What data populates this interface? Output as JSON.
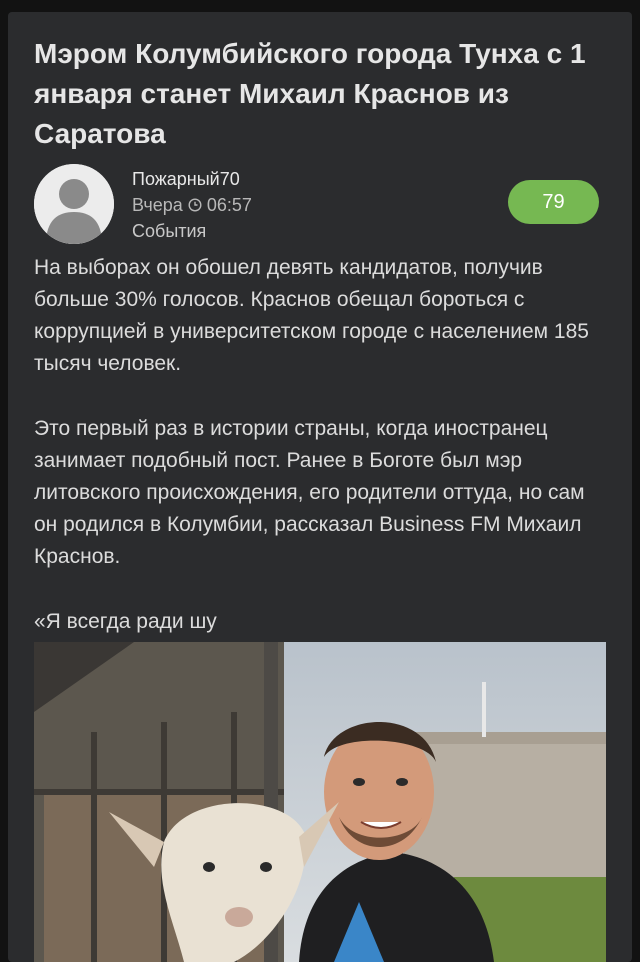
{
  "post": {
    "title": "Мэром Колумбийского города Тунха с 1 января станет Михаил Краснов из Саратова",
    "author": "Пожарный70",
    "date": "Вчера",
    "time": "06:57",
    "category": "События",
    "rating": "79",
    "paragraphs": [
      "На выборах он обошел девять кандидатов, получив больше 30% голосов. Краснов обещал бороться с коррупцией в университетском городе с населением 185 тысяч человек.",
      "Это первый раз в истории страны, когда иностранец занимает подобный пост. Ранее в Боготе был мэр литовского происхождения, его родители оттуда, но сам он родился в Колумбии, рассказал Business FM Михаил Краснов.",
      "«Я всегда ради шу"
    ]
  },
  "icons": {
    "avatar": "user-placeholder-icon",
    "clock": "clock-icon"
  },
  "colors": {
    "card_bg": "#2b2c2e",
    "rating_bg": "#76b852"
  }
}
